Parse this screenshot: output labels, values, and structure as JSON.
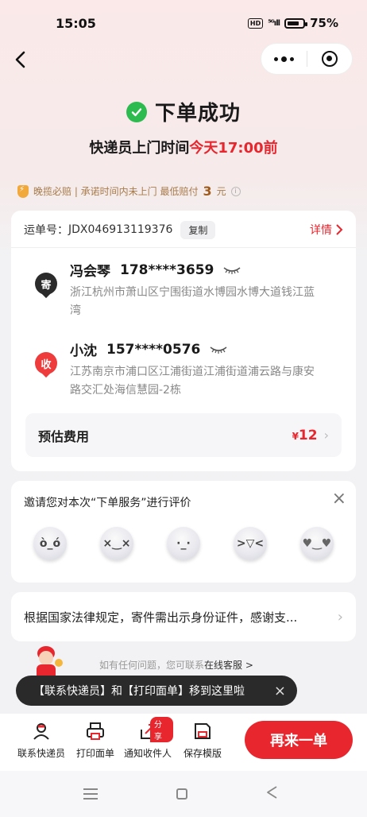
{
  "status_bar": {
    "time": "15:05",
    "network": "HD",
    "signal": "⁵ᴳıll",
    "battery": "75%"
  },
  "header": {
    "title": "下单成功",
    "subtitle_prefix": "快递员上门时间",
    "subtitle_time": "今天17:00前"
  },
  "guarantee": {
    "text_prefix": "晚揽必赔 | 承诺时间内未上门 最低赔付",
    "amount": "3",
    "unit": "元"
  },
  "order": {
    "tracking_label": "运单号：",
    "tracking_no": "JDX046913119376",
    "copy_label": "复制",
    "detail_label": "详情",
    "sender": {
      "tag": "寄",
      "name": "冯会琴",
      "phone": "178****3659",
      "address": "浙江杭州市萧山区宁围街道水博园水博大道钱江蓝湾"
    },
    "receiver": {
      "tag": "收",
      "name": "小沈",
      "phone": "157****0576",
      "address": "江苏南京市浦口区江浦街道江浦街道浦云路与康安路交汇处海信慧园-2栋"
    },
    "fee_label": "预估费用",
    "fee_currency": "¥",
    "fee_value": "12"
  },
  "rating": {
    "title": "邀请您对本次“下单服务”进行评价",
    "faces": [
      "angry-face-icon",
      "dizzy-face-icon",
      "neutral-face-icon",
      "laughing-face-icon",
      "heart-eyes-face-icon"
    ]
  },
  "notice": {
    "text": "根据国家法律规定，寄件需出示身份证件，感谢支..."
  },
  "help": {
    "prefix": "如有任何问题，您可联系",
    "link": "在线客服",
    "arrow": ">"
  },
  "toast": {
    "text": "【联系快递员】和【打印面单】移到这里啦"
  },
  "bottom_actions": [
    {
      "label": "联系快递员"
    },
    {
      "label": "打印面单"
    },
    {
      "label": "通知收件人",
      "badge": "分享"
    },
    {
      "label": "保存模版"
    }
  ],
  "reorder_label": "再来一单",
  "colors": {
    "accent": "#e8262e",
    "success": "#2dbb4f"
  }
}
